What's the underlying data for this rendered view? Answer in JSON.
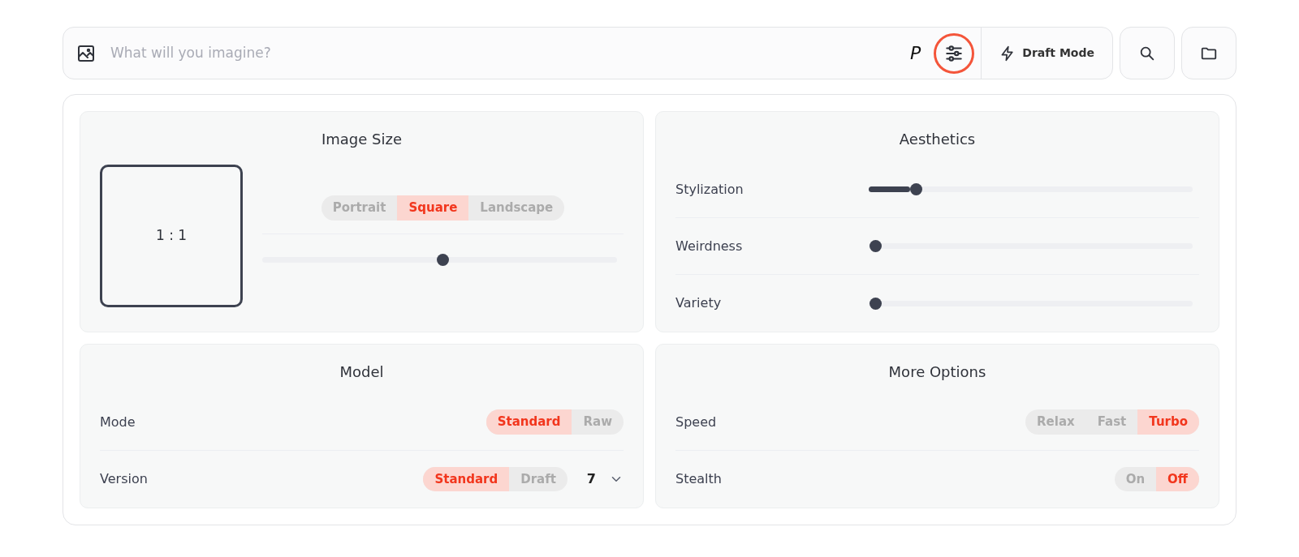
{
  "prompt": {
    "placeholder": "What will you imagine?",
    "suffix": "P",
    "settings_highlighted": true,
    "draft_mode": "Draft Mode"
  },
  "cards": [
    {
      "kind": "image_size",
      "title": "Image Size",
      "ratio": "1 : 1",
      "options": [
        {
          "label": "Portrait",
          "selected": false
        },
        {
          "label": "Square",
          "selected": true
        },
        {
          "label": "Landscape",
          "selected": false
        }
      ],
      "level": 0.5
    },
    {
      "kind": "sliders",
      "title": "Aesthetics",
      "rows": [
        {
          "label": "Stylization",
          "level": 0.13
        },
        {
          "label": "Weirdness",
          "level": 0
        },
        {
          "label": "Variety",
          "level": 0
        }
      ]
    },
    {
      "kind": "toggles",
      "title": "Model",
      "rows": [
        {
          "label": "Mode",
          "options": [
            {
              "label": "Standard",
              "selected": true
            },
            {
              "label": "Raw",
              "selected": false
            }
          ]
        },
        {
          "label": "Version",
          "options": [
            {
              "label": "Standard",
              "selected": true
            },
            {
              "label": "Draft",
              "selected": false
            }
          ],
          "version": "7"
        }
      ]
    },
    {
      "kind": "toggles",
      "title": "More Options",
      "rows": [
        {
          "label": "Speed",
          "options": [
            {
              "label": "Relax",
              "selected": false
            },
            {
              "label": "Fast",
              "selected": false
            },
            {
              "label": "Turbo",
              "selected": true
            }
          ]
        },
        {
          "label": "Stealth",
          "options": [
            {
              "label": "On",
              "selected": false
            },
            {
              "label": "Off",
              "selected": true
            }
          ]
        }
      ]
    }
  ]
}
